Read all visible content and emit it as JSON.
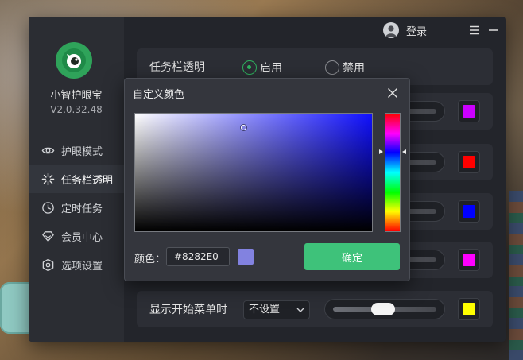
{
  "app": {
    "name": "小智护眼宝",
    "version": "V2.0.32.48"
  },
  "titlebar": {
    "login_label": "登录"
  },
  "sidebar": {
    "items": [
      {
        "label": "护眼模式",
        "icon": "eye-icon",
        "active": false
      },
      {
        "label": "任务栏透明",
        "icon": "sparkle-icon",
        "active": true
      },
      {
        "label": "定时任务",
        "icon": "clock-icon",
        "active": false
      },
      {
        "label": "会员中心",
        "icon": "diamond-icon",
        "active": false
      },
      {
        "label": "选项设置",
        "icon": "hexagon-settings-icon",
        "active": false
      }
    ]
  },
  "main": {
    "taskbar_row": {
      "label": "任务栏透明",
      "enable_label": "启用",
      "disable_label": "禁用",
      "selected": "启用"
    },
    "color_swatches": [
      "#CC00FF",
      "#FF0000",
      "#0000FF",
      "#FF00FF",
      "#FFFF00"
    ],
    "start_menu_row": {
      "label": "显示开始菜单时",
      "select_value": "不设置"
    }
  },
  "dialog": {
    "title": "自定义颜色",
    "color_label": "颜色：",
    "hex_value": "#8282E0",
    "preview_color": "#8282E0",
    "confirm_label": "确定"
  },
  "colors": {
    "accent": "#3EC27A",
    "window_bg": "#23252B",
    "sidebar_bg": "#2B2D33"
  }
}
